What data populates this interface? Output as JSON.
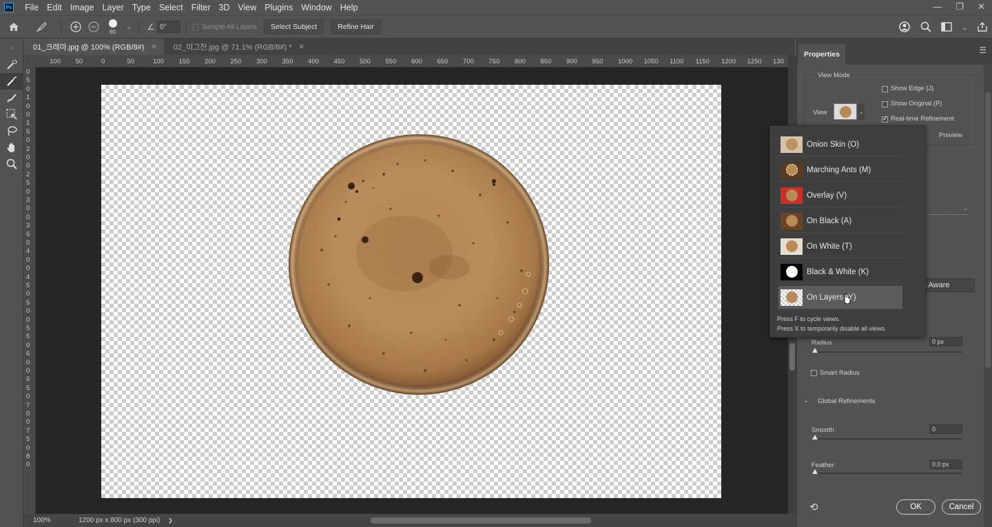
{
  "app": {
    "logo": "Ps",
    "menu": [
      "File",
      "Edit",
      "Image",
      "Layer",
      "Type",
      "Select",
      "Filter",
      "3D",
      "View",
      "Plugins",
      "Window",
      "Help"
    ],
    "window_controls": [
      "minimize-icon",
      "restore-icon",
      "close-icon"
    ]
  },
  "options": {
    "brush_size": "60",
    "angle": "0°",
    "sample_all_layers": "Sample All Layers",
    "select_subject": "Select Subject",
    "refine_hair": "Refine Hair"
  },
  "tabs": [
    {
      "label": "01_크레마.jpg @ 100% (RGB/8#)",
      "active": true
    },
    {
      "label": "02_미그잔.jpg @ 71.1% (RGB/8#) *",
      "active": false
    }
  ],
  "ruler": {
    "top": [
      "100",
      "50",
      "0",
      "50",
      "100",
      "150",
      "200",
      "250",
      "300",
      "350",
      "400",
      "450",
      "500",
      "550",
      "600",
      "650",
      "700",
      "750",
      "800",
      "850",
      "900",
      "950",
      "1000",
      "1050",
      "1100",
      "1150",
      "1200",
      "1250",
      "130"
    ],
    "left": [
      "0",
      "5",
      "0",
      "1",
      "0",
      "0",
      "1",
      "5",
      "0",
      "2",
      "0",
      "0",
      "2",
      "5",
      "0",
      "3",
      "0",
      "0",
      "3",
      "5",
      "0",
      "4",
      "0",
      "0",
      "4",
      "5",
      "0",
      "5",
      "0",
      "0",
      "5",
      "5",
      "0",
      "6",
      "0",
      "0",
      "6",
      "5",
      "0",
      "7",
      "0",
      "0",
      "7",
      "5",
      "0",
      "8",
      "0"
    ]
  },
  "status": {
    "zoom": "100%",
    "doc_size": "1200 px x 800 px (300 ppi)",
    "arrow": "❯"
  },
  "properties": {
    "tab": "Properties",
    "view_mode_heading": "View Mode",
    "view_label": "View",
    "show_edge": "Show Edge (J)",
    "show_original": "Show Original (P)",
    "realtime": "Real-time Refinement",
    "preview": "Preview",
    "content_aware_partial": "t Aware",
    "radius_label": "Radius",
    "radius_value": "0 px",
    "smart_radius": "Smart Radius",
    "global_refinements": "Global Refinements",
    "smooth_label": "Smooth",
    "smooth_value": "0",
    "feather_label": "Feather",
    "feather_value": "0.0 px",
    "ok": "OK",
    "cancel": "Cancel"
  },
  "view_menu": {
    "items": [
      {
        "label": "Onion Skin (O)",
        "thumb": "onion"
      },
      {
        "label": "Marching Ants (M)",
        "thumb": "ants"
      },
      {
        "label": "Overlay (V)",
        "thumb": "overlay"
      },
      {
        "label": "On Black (A)",
        "thumb": "black"
      },
      {
        "label": "On White (T)",
        "thumb": "white"
      },
      {
        "label": "Black & White (K)",
        "thumb": "bw"
      },
      {
        "label": "On Layers (Y)",
        "thumb": "layers"
      }
    ],
    "hint1": "Press F to cycle views.",
    "hint2": "Press X to temporarily disable all views."
  },
  "colors": {
    "ui_bg": "#535353",
    "canvas_bg": "#262626",
    "coffee": "#b88a55",
    "accent": "#31a8ff"
  }
}
